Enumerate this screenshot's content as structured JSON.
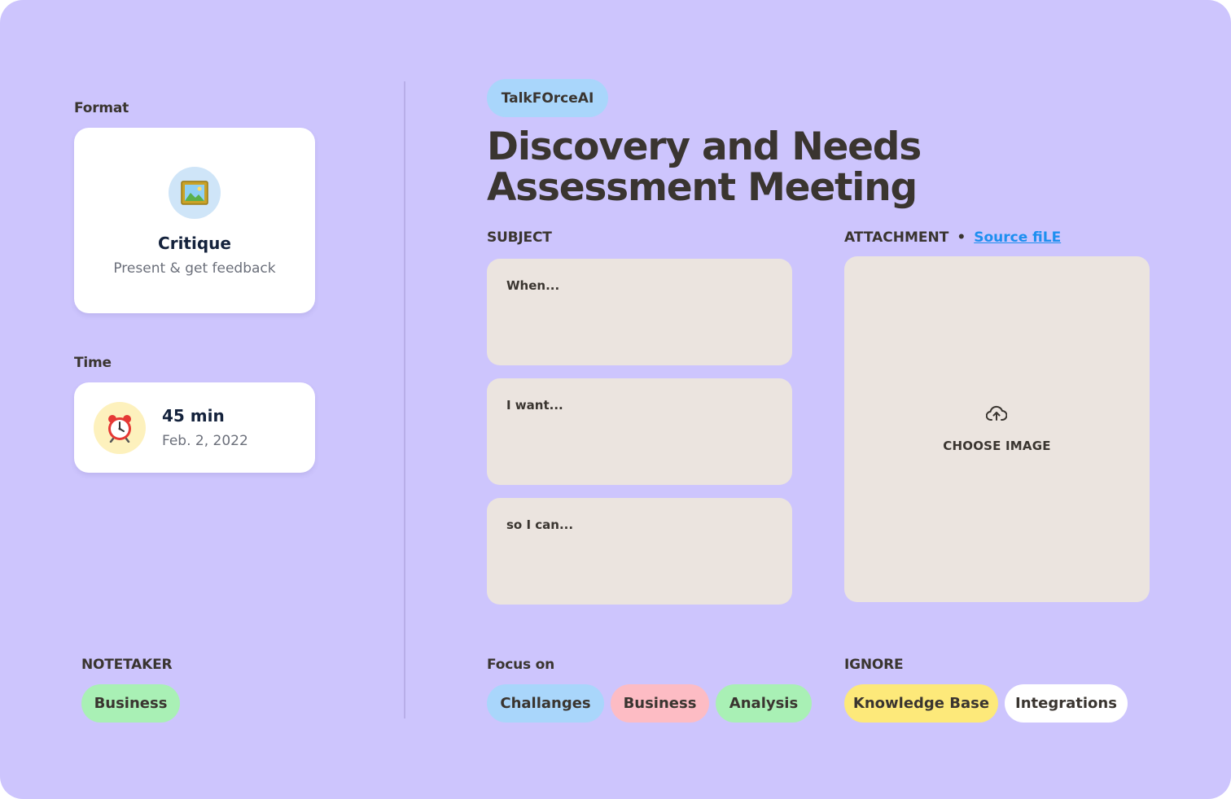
{
  "format": {
    "label": "Format",
    "card": {
      "icon": "framed-picture-icon",
      "title": "Critique",
      "subtitle": "Present & get feedback"
    }
  },
  "time": {
    "label": "Time",
    "card": {
      "icon": "alarm-clock-icon",
      "duration": "45 min",
      "date": "Feb. 2, 2022"
    }
  },
  "notetaker": {
    "label": "NOTETAKER",
    "tags": [
      {
        "label": "Business",
        "color": "#a9f0b5"
      }
    ]
  },
  "header": {
    "brand": "TalkFOrceAI",
    "title_line1": "Discovery and Needs",
    "title_line2": "Assessment Meeting"
  },
  "subject": {
    "label": "SUBJECT",
    "fields": [
      {
        "placeholder": "When..."
      },
      {
        "placeholder": "I want..."
      },
      {
        "placeholder": "so I can..."
      }
    ]
  },
  "attachment": {
    "label": "ATTACHMENT",
    "separator": "•",
    "link": "Source fiLE",
    "upload_icon": "cloud-upload-icon",
    "choose_label": "CHOOSE IMAGE"
  },
  "focus": {
    "label": "Focus on",
    "tags": [
      {
        "label": "Challanges",
        "color": "#a9d6fb"
      },
      {
        "label": "Business",
        "color": "#fdbcc4"
      },
      {
        "label": "Analysis",
        "color": "#a9f0b5"
      }
    ]
  },
  "ignore": {
    "label": "IGNORE",
    "tags": [
      {
        "label": "Knowledge Base",
        "color": "#fde97a"
      },
      {
        "label": "Integrations",
        "color": "#ffffff"
      }
    ]
  },
  "colors": {
    "background": "#cdc5fd",
    "field": "#ebe4df",
    "link": "#1d8ff0",
    "text": "#3a3530"
  }
}
